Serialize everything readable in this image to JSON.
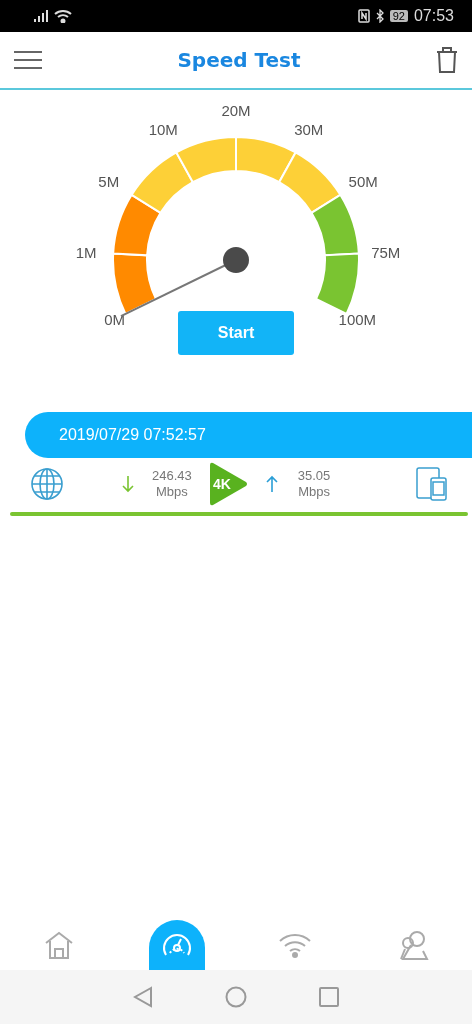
{
  "status_bar": {
    "battery": "92",
    "time": "07:53"
  },
  "header": {
    "title": "Speed Test"
  },
  "gauge": {
    "labels": [
      "0M",
      "1M",
      "5M",
      "10M",
      "20M",
      "30M",
      "50M",
      "75M",
      "100M"
    ]
  },
  "start_button": "Start",
  "result": {
    "timestamp": "2019/07/29 07:52:57",
    "download": "246.43",
    "download_unit": "Mbps",
    "badge": "4K",
    "upload": "35.05",
    "upload_unit": "Mbps"
  },
  "bottom_nav": [
    {
      "kind": "home",
      "selected": false
    },
    {
      "kind": "speed",
      "selected": true
    },
    {
      "kind": "wifi",
      "selected": false
    },
    {
      "kind": "users",
      "selected": false
    }
  ]
}
